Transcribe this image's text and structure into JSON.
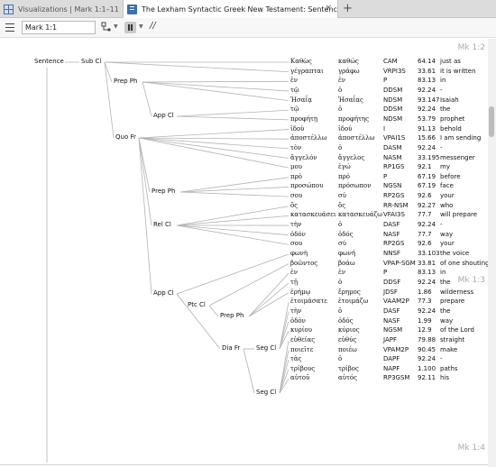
{
  "tabs": {
    "inactive_label": "Visualizations | Mark 1:1–11",
    "active_label": "The Lexham Syntactic Greek New Testament: Sentence Analysis",
    "close_glyph": "×",
    "new_tab_glyph": "+"
  },
  "toolbar": {
    "reference": "Mark 1:1",
    "parallel_glyph": "//"
  },
  "verse_markers": [
    "Mk 1:2",
    "Mk 1:3",
    "Mk 1:4"
  ],
  "nodes": {
    "sentence": "Sentence",
    "subcl": "Sub Cl",
    "prepph1": "Prep Ph",
    "appcl1": "App Cl",
    "quofr": "Quo Fr",
    "prepph2": "Prep Ph",
    "relcl": "Rel Cl",
    "appcl2": "App Cl",
    "ptccl": "Ptc Cl",
    "prepph3": "Prep Ph",
    "diafr": "Dia Fr",
    "segcl1": "Seg Cl",
    "segcl2": "Seg Cl"
  },
  "rows": [
    {
      "word": "Καθὼς",
      "lemma": "καθώς",
      "morph": "CAM",
      "num": "64.14",
      "gloss": "just as"
    },
    {
      "word": "γέγραπται",
      "lemma": "γράφω",
      "morph": "VRPI3S",
      "num": "33.61",
      "gloss": "it is written"
    },
    {
      "word": "ἐν",
      "lemma": "ἐν",
      "morph": "P",
      "num": "83.13",
      "gloss": "in"
    },
    {
      "word": "τῷ",
      "lemma": "ὁ",
      "morph": "DDSM",
      "num": "92.24",
      "gloss": "-"
    },
    {
      "word": "Ἠσαΐᾳ",
      "lemma": "Ἠσαΐας",
      "morph": "NDSM",
      "num": "93.147",
      "gloss": "Isaiah"
    },
    {
      "word": "τῷ",
      "lemma": "ὁ",
      "morph": "DDSM",
      "num": "92.24",
      "gloss": "the"
    },
    {
      "word": "προφήτῃ",
      "lemma": "προφήτης",
      "morph": "NDSM",
      "num": "53.79",
      "gloss": "prophet"
    },
    {
      "word": "ἰδοὺ",
      "lemma": "ἰδού",
      "morph": "I",
      "num": "91.13",
      "gloss": "behold"
    },
    {
      "word": "ἀποστέλλω",
      "lemma": "ἀποστέλλω",
      "morph": "VPAI1S",
      "num": "15.66",
      "gloss": "I am sending"
    },
    {
      "word": "τὸν",
      "lemma": "ὁ",
      "morph": "DASM",
      "num": "92.24",
      "gloss": "-"
    },
    {
      "word": "ἄγγελόν",
      "lemma": "ἄγγελος",
      "morph": "NASM",
      "num": "33.195",
      "gloss": "messenger"
    },
    {
      "word": "μου",
      "lemma": "ἐγώ",
      "morph": "RP1GS",
      "num": "92.1",
      "gloss": "my"
    },
    {
      "word": "πρὸ",
      "lemma": "πρό",
      "morph": "P",
      "num": "67.19",
      "gloss": "before"
    },
    {
      "word": "προσώπου",
      "lemma": "πρόσωπον",
      "morph": "NGSN",
      "num": "67.19",
      "gloss": "face"
    },
    {
      "word": "σου",
      "lemma": "σύ",
      "morph": "RP2GS",
      "num": "92.6",
      "gloss": "your"
    },
    {
      "word": "ὃς",
      "lemma": "ὅς",
      "morph": "RR-NSM",
      "num": "92.27",
      "gloss": "who"
    },
    {
      "word": "κατασκευάσει",
      "lemma": "κατασκευάζω",
      "morph": "VFAI3S",
      "num": "77.7",
      "gloss": "will prepare"
    },
    {
      "word": "τὴν",
      "lemma": "ὁ",
      "morph": "DASF",
      "num": "92.24",
      "gloss": "-"
    },
    {
      "word": "ὁδόν",
      "lemma": "ὁδός",
      "morph": "NASF",
      "num": "77.7",
      "gloss": "way"
    },
    {
      "word": "σου",
      "lemma": "σύ",
      "morph": "RP2GS",
      "num": "92.6",
      "gloss": "your"
    },
    {
      "word": "φωνὴ",
      "lemma": "φωνή",
      "morph": "NNSF",
      "num": "33.103",
      "gloss": "the voice"
    },
    {
      "word": "βοῶντος",
      "lemma": "βοάω",
      "morph": "VPAP-SGM",
      "num": "33.81",
      "gloss": "of one shouting"
    },
    {
      "word": "ἐν",
      "lemma": "ἐν",
      "morph": "P",
      "num": "83.13",
      "gloss": "in"
    },
    {
      "word": "τῇ",
      "lemma": "ὁ",
      "morph": "DDSF",
      "num": "92.24",
      "gloss": "the"
    },
    {
      "word": "ἐρήμῳ",
      "lemma": "ἔρημος",
      "morph": "JDSF",
      "num": "1.86",
      "gloss": "wilderness"
    },
    {
      "word": "ἑτοιμάσατε",
      "lemma": "ἑτοιμάζω",
      "morph": "VAAM2P",
      "num": "77.3",
      "gloss": "prepare"
    },
    {
      "word": "τὴν",
      "lemma": "ὁ",
      "morph": "DASF",
      "num": "92.24",
      "gloss": "the"
    },
    {
      "word": "ὁδὸν",
      "lemma": "ὁδός",
      "morph": "NASF",
      "num": "1.99",
      "gloss": "way"
    },
    {
      "word": "κυρίου",
      "lemma": "κύριος",
      "morph": "NGSM",
      "num": "12.9",
      "gloss": "of the Lord"
    },
    {
      "word": "εὐθείας",
      "lemma": "εὐθύς",
      "morph": "JAPF",
      "num": "79.88",
      "gloss": "straight"
    },
    {
      "word": "ποιεῖτε",
      "lemma": "ποιέω",
      "morph": "VPAM2P",
      "num": "90.45",
      "gloss": "make"
    },
    {
      "word": "τὰς",
      "lemma": "ὁ",
      "morph": "DAPF",
      "num": "92.24",
      "gloss": "-"
    },
    {
      "word": "τρίβους",
      "lemma": "τρίβος",
      "morph": "NAPF",
      "num": "1.100",
      "gloss": "paths"
    },
    {
      "word": "αὐτοῦ",
      "lemma": "αὐτός",
      "morph": "RP3GSM",
      "num": "92.11",
      "gloss": "his"
    }
  ]
}
